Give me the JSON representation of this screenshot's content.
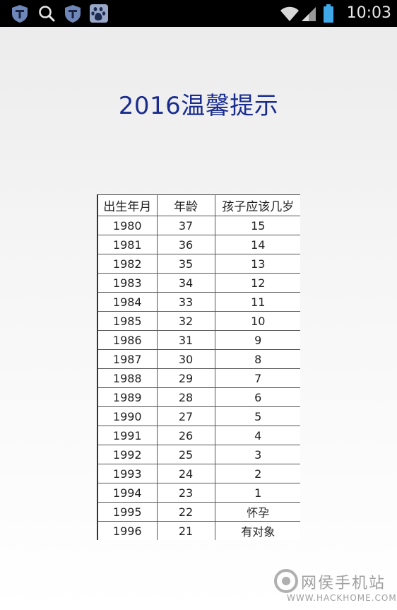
{
  "status_bar": {
    "time": "10:03",
    "icons": [
      "shield-icon",
      "search-icon",
      "shield-icon",
      "baidu-paw-icon",
      "wifi-icon",
      "signal-icon",
      "battery-icon"
    ]
  },
  "title": "2016温馨提示",
  "table": {
    "headers": [
      "出生年月",
      "年龄",
      "孩子应该几岁"
    ],
    "rows": [
      [
        "1980",
        "37",
        "15"
      ],
      [
        "1981",
        "36",
        "14"
      ],
      [
        "1982",
        "35",
        "13"
      ],
      [
        "1983",
        "34",
        "12"
      ],
      [
        "1984",
        "33",
        "11"
      ],
      [
        "1985",
        "32",
        "10"
      ],
      [
        "1986",
        "31",
        "9"
      ],
      [
        "1987",
        "30",
        "8"
      ],
      [
        "1988",
        "29",
        "7"
      ],
      [
        "1989",
        "28",
        "6"
      ],
      [
        "1990",
        "27",
        "5"
      ],
      [
        "1991",
        "26",
        "4"
      ],
      [
        "1992",
        "25",
        "3"
      ],
      [
        "1993",
        "24",
        "2"
      ],
      [
        "1994",
        "23",
        "1"
      ],
      [
        "1995",
        "22",
        "怀孕"
      ],
      [
        "1996",
        "21",
        "有对象"
      ]
    ]
  },
  "watermark": {
    "name": "网侯手机站",
    "url": "WWW.HACKHOME.COM"
  }
}
